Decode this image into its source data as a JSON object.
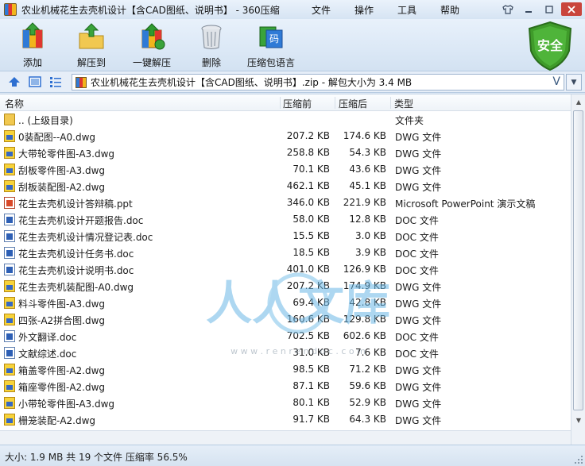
{
  "window": {
    "title": "农业机械花生去壳机设计【含CAD图纸、说明书】 - 360压缩",
    "menu": [
      "文件",
      "操作",
      "工具",
      "帮助"
    ],
    "controls": [
      "shirt-icon",
      "minimize-icon",
      "maximize-icon",
      "close-icon"
    ]
  },
  "toolbar": {
    "add": "添加",
    "extract_to": "解压到",
    "one_click_extract": "一键解压",
    "delete": "删除",
    "zip_language": "压缩包语言",
    "security_badge": "安全"
  },
  "address": {
    "path_text": "农业机械花生去壳机设计【含CAD图纸、说明书】.zip - 解包大小为 3.4 MB",
    "dropdown_glyph": "V"
  },
  "columns": {
    "name": "名称",
    "size": "压缩前",
    "packed": "压缩后",
    "type": "类型"
  },
  "files": [
    {
      "icon": "folder",
      "name": ".. (上级目录)",
      "size": "",
      "packed": "",
      "type": "文件夹"
    },
    {
      "icon": "dwg",
      "name": "0装配图--A0.dwg",
      "size": "207.2 KB",
      "packed": "174.6 KB",
      "type": "DWG 文件"
    },
    {
      "icon": "dwg",
      "name": "大带轮零件图-A3.dwg",
      "size": "258.8 KB",
      "packed": "54.3 KB",
      "type": "DWG 文件"
    },
    {
      "icon": "dwg",
      "name": "刮板零件图-A3.dwg",
      "size": "70.1 KB",
      "packed": "43.6 KB",
      "type": "DWG 文件"
    },
    {
      "icon": "dwg",
      "name": "刮板装配图-A2.dwg",
      "size": "462.1 KB",
      "packed": "45.1 KB",
      "type": "DWG 文件"
    },
    {
      "icon": "ppt",
      "name": "花生去壳机设计答辩稿.ppt",
      "size": "346.0 KB",
      "packed": "221.9 KB",
      "type": "Microsoft PowerPoint 演示文稿"
    },
    {
      "icon": "doc",
      "name": "花生去壳机设计开题报告.doc",
      "size": "58.0 KB",
      "packed": "12.8 KB",
      "type": "DOC 文件"
    },
    {
      "icon": "doc",
      "name": "花生去壳机设计情况登记表.doc",
      "size": "15.5 KB",
      "packed": "3.0 KB",
      "type": "DOC 文件"
    },
    {
      "icon": "doc",
      "name": "花生去壳机设计任务书.doc",
      "size": "18.5 KB",
      "packed": "3.9 KB",
      "type": "DOC 文件"
    },
    {
      "icon": "doc",
      "name": "花生去壳机设计说明书.doc",
      "size": "401.0 KB",
      "packed": "126.9 KB",
      "type": "DOC 文件"
    },
    {
      "icon": "dwg",
      "name": "花生去壳机装配图-A0.dwg",
      "size": "207.2 KB",
      "packed": "174.9 KB",
      "type": "DWG 文件"
    },
    {
      "icon": "dwg",
      "name": "料斗零件图-A3.dwg",
      "size": "69.4 KB",
      "packed": "42.8 KB",
      "type": "DWG 文件"
    },
    {
      "icon": "dwg",
      "name": "四张-A2拼合图.dwg",
      "size": "160.6 KB",
      "packed": "129.8 KB",
      "type": "DWG 文件"
    },
    {
      "icon": "doc",
      "name": "外文翻译.doc",
      "size": "702.5 KB",
      "packed": "602.6 KB",
      "type": "DOC 文件"
    },
    {
      "icon": "doc",
      "name": "文献综述.doc",
      "size": "31.0 KB",
      "packed": "7.6 KB",
      "type": "DOC 文件"
    },
    {
      "icon": "dwg",
      "name": "箱盖零件图-A2.dwg",
      "size": "98.5 KB",
      "packed": "71.2 KB",
      "type": "DWG 文件"
    },
    {
      "icon": "dwg",
      "name": "箱座零件图-A2.dwg",
      "size": "87.1 KB",
      "packed": "59.6 KB",
      "type": "DWG 文件"
    },
    {
      "icon": "dwg",
      "name": "小带轮零件图-A3.dwg",
      "size": "80.1 KB",
      "packed": "52.9 KB",
      "type": "DWG 文件"
    },
    {
      "icon": "dwg",
      "name": "栅笼装配-A2.dwg",
      "size": "91.7 KB",
      "packed": "64.3 KB",
      "type": "DWG 文件"
    }
  ],
  "watermark": {
    "text": "人人文库",
    "url": "w w w . r e n r e n d o c . c o m"
  },
  "status": {
    "text": "大小: 1.9 MB 共 19 个文件 压缩率 56.5%"
  },
  "colors": {
    "accent": "#2d6fd1",
    "shield": "#3f9b2a",
    "close": "#c9453c"
  }
}
